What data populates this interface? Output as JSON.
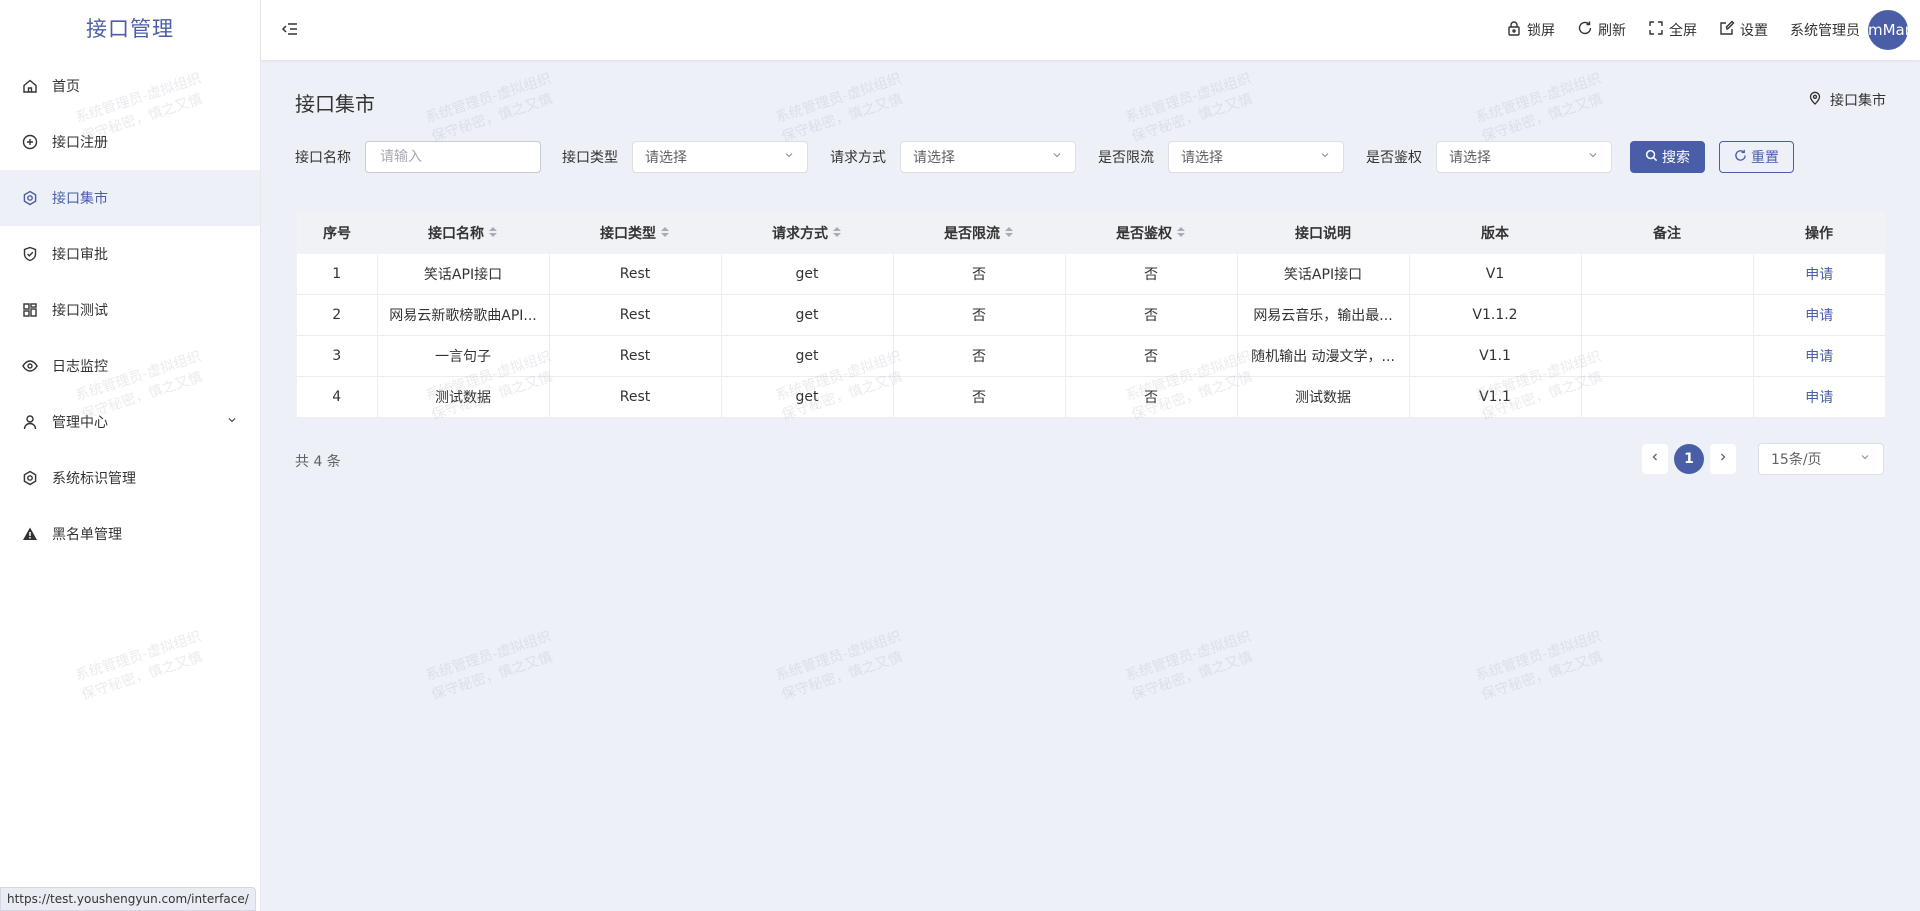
{
  "app": {
    "title": "接口管理"
  },
  "sidebar": {
    "items": [
      {
        "label": "首页",
        "icon": "home-icon",
        "active": false
      },
      {
        "label": "接口注册",
        "icon": "plus-circle-icon",
        "active": false
      },
      {
        "label": "接口集市",
        "icon": "gear-icon",
        "active": true
      },
      {
        "label": "接口审批",
        "icon": "shield-check-icon",
        "active": false
      },
      {
        "label": "接口测试",
        "icon": "grid-icon",
        "active": false
      },
      {
        "label": "日志监控",
        "icon": "eye-icon",
        "active": false
      },
      {
        "label": "管理中心",
        "icon": "user-icon",
        "active": false,
        "expandable": true
      },
      {
        "label": "系统标识管理",
        "icon": "gear-icon",
        "active": false
      },
      {
        "label": "黑名单管理",
        "icon": "warning-icon",
        "active": false
      }
    ]
  },
  "topbar": {
    "lock": "锁屏",
    "refresh": "刷新",
    "fullscreen": "全屏",
    "settings": "设置",
    "user": "系统管理员",
    "avatar_text": "mMar"
  },
  "page": {
    "title": "接口集市",
    "breadcrumb": "接口集市"
  },
  "filters": {
    "name_label": "接口名称",
    "name_placeholder": "请输入",
    "type_label": "接口类型",
    "type_value": "请选择",
    "method_label": "请求方式",
    "method_value": "请选择",
    "limit_label": "是否限流",
    "limit_value": "请选择",
    "auth_label": "是否鉴权",
    "auth_value": "请选择",
    "search_button": "搜索",
    "reset_button": "重置"
  },
  "table": {
    "headers": [
      "序号",
      "接口名称",
      "接口类型",
      "请求方式",
      "是否限流",
      "是否鉴权",
      "接口说明",
      "版本",
      "备注",
      "操作"
    ],
    "rows": [
      [
        "1",
        "笑话API接口",
        "Rest",
        "get",
        "否",
        "否",
        "笑话API接口",
        "V1",
        "",
        "申请"
      ],
      [
        "2",
        "网易云新歌榜歌曲API...",
        "Rest",
        "get",
        "否",
        "否",
        "网易云音乐，输出最...",
        "V1.1.2",
        "",
        "申请"
      ],
      [
        "3",
        "一言句子",
        "Rest",
        "get",
        "否",
        "否",
        "随机输出 动漫文学，...",
        "V1.1",
        "",
        "申请"
      ],
      [
        "4",
        "测试数据",
        "Rest",
        "get",
        "否",
        "否",
        "测试数据",
        "V1.1",
        "",
        "申请"
      ]
    ]
  },
  "pagination": {
    "total_text": "共 4 条",
    "current_page": "1",
    "page_size": "15条/页"
  },
  "status_url": "https://test.youshengyun.com/interface/",
  "watermark": {
    "line1": "系统管理员-虚拟组织",
    "line2": "保守秘密，慎之又慎"
  },
  "colors": {
    "accent": "#4a5ea8",
    "background": "#edf0f6"
  }
}
